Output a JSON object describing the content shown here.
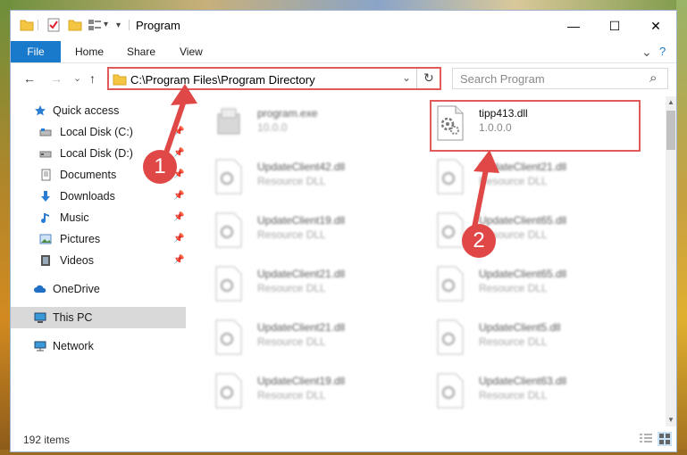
{
  "window": {
    "title": "Program",
    "minimize_glyph": "—",
    "maximize_glyph": "☐",
    "close_glyph": "✕"
  },
  "ribbon": {
    "tabs": [
      "File",
      "Home",
      "Share",
      "View"
    ],
    "expand_glyph": "⌄",
    "help_glyph": "?"
  },
  "nav": {
    "back_glyph": "←",
    "forward_glyph": "→",
    "recent_glyph": "⌄",
    "up_glyph": "↑",
    "address": "C:\\Program Files\\Program Directory",
    "refresh_glyph": "↻",
    "dropdown_glyph": "⌄",
    "search_placeholder": "Search Program",
    "search_glyph": "⌕"
  },
  "sidebar": {
    "items": [
      {
        "label": "Quick access",
        "icon": "star-icon",
        "pinned": false
      },
      {
        "label": "Local Disk (C:)",
        "icon": "drive-icon",
        "pinned": true
      },
      {
        "label": "Local Disk (D:)",
        "icon": "drive-icon",
        "pinned": true
      },
      {
        "label": "Documents",
        "icon": "documents-icon",
        "pinned": true
      },
      {
        "label": "Downloads",
        "icon": "downloads-icon",
        "pinned": true
      },
      {
        "label": "Music",
        "icon": "music-icon",
        "pinned": true
      },
      {
        "label": "Pictures",
        "icon": "pictures-icon",
        "pinned": true
      },
      {
        "label": "Videos",
        "icon": "videos-icon",
        "pinned": true
      },
      {
        "label": "OneDrive",
        "icon": "onedrive-icon",
        "pinned": false
      },
      {
        "label": "This PC",
        "icon": "computer-icon",
        "pinned": false,
        "selected": true
      },
      {
        "label": "Network",
        "icon": "network-icon",
        "pinned": false
      }
    ],
    "pin_glyph": "📌"
  },
  "files": [
    {
      "name": "program.exe",
      "sub": "10.0.0"
    },
    {
      "name": "tipp413.dll",
      "sub": "1.0.0.0"
    },
    {
      "name": "UpdateClient42.dll",
      "sub": "Resource DLL"
    },
    {
      "name": "UpdateClient21.dll",
      "sub": "Resource DLL"
    },
    {
      "name": "UpdateClient19.dll",
      "sub": "Resource DLL"
    },
    {
      "name": "UpdateClient65.dll",
      "sub": "Resource DLL"
    },
    {
      "name": "UpdateClient21.dll",
      "sub": "Resource DLL"
    },
    {
      "name": "UpdateClient65.dll",
      "sub": "Resource DLL"
    },
    {
      "name": "UpdateClient21.dll",
      "sub": "Resource DLL"
    },
    {
      "name": "UpdateClient5.dll",
      "sub": "Resource DLL"
    },
    {
      "name": "UpdateClient19.dll",
      "sub": "Resource DLL"
    },
    {
      "name": "UpdateClient63.dll",
      "sub": "Resource DLL"
    }
  ],
  "status": {
    "item_count": "192 items"
  },
  "annotations": {
    "badge1": "1",
    "badge2": "2",
    "color": "#e04848"
  }
}
